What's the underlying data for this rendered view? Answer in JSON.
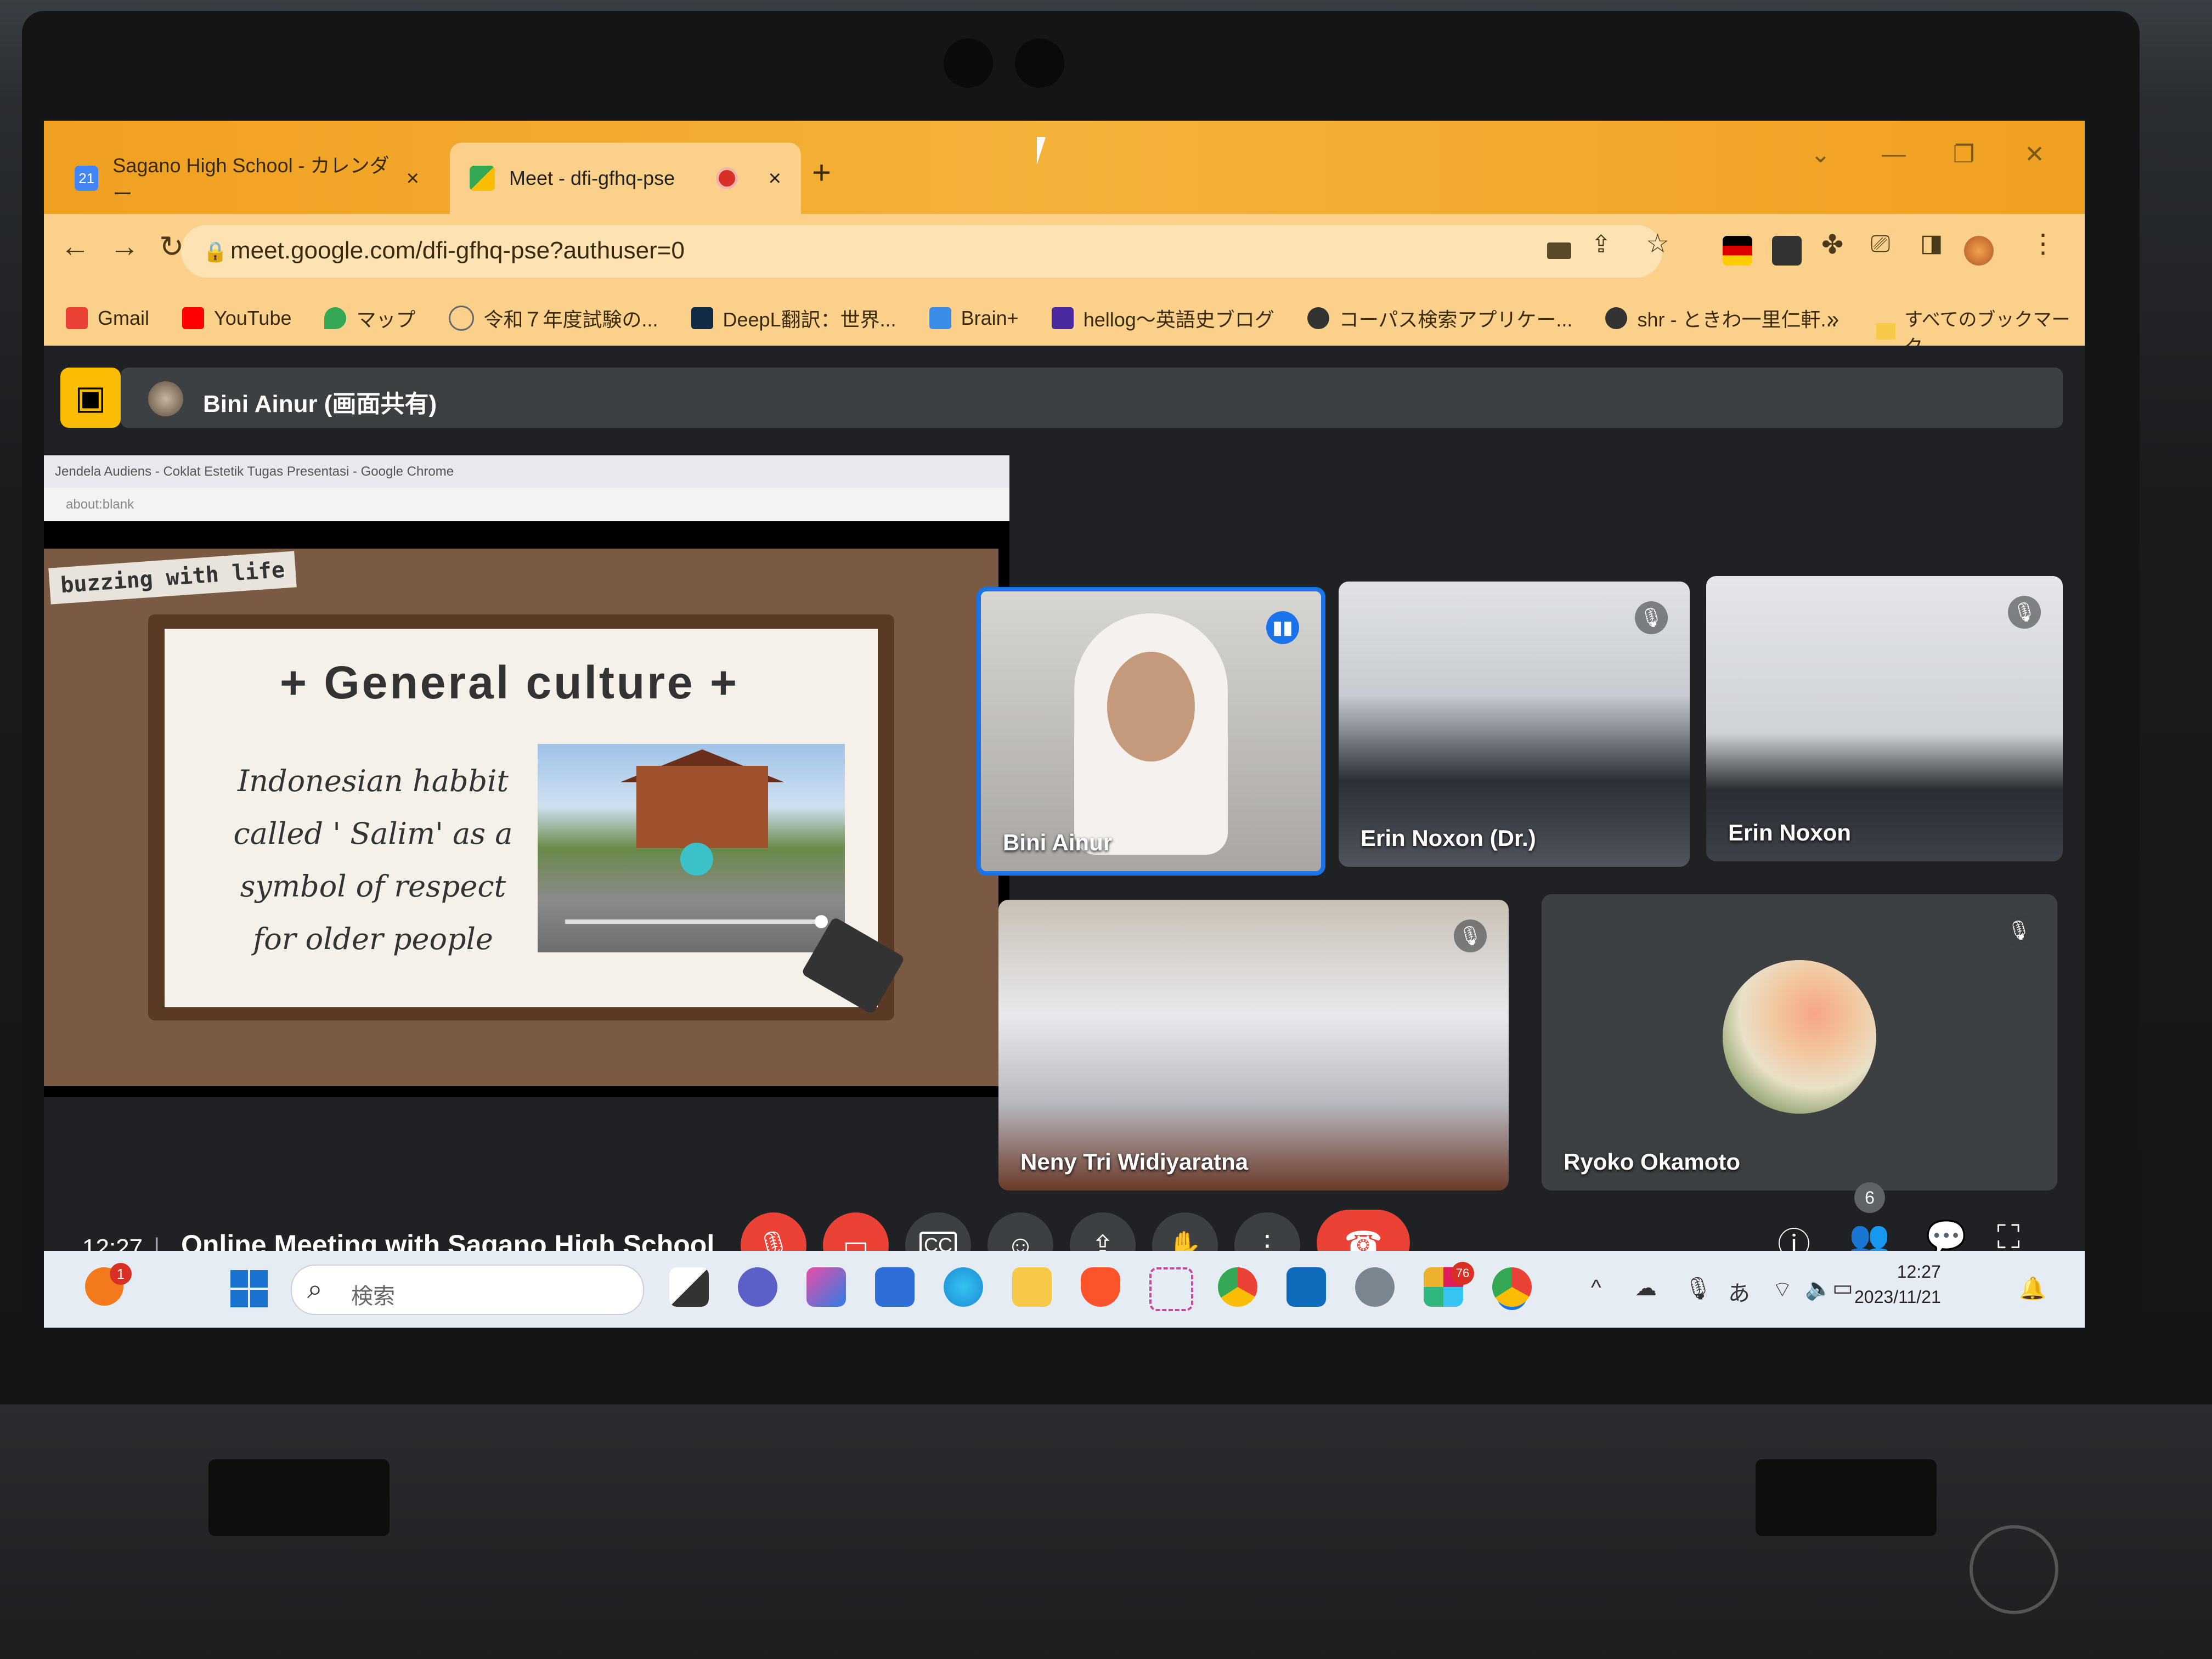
{
  "browser": {
    "tabs": [
      {
        "title": "Sagano High School - カレンダー",
        "favicon": "calendar-icon",
        "close": "×"
      },
      {
        "title": "Meet - dfi-gfhq-pse",
        "favicon": "meet-icon",
        "close": "×"
      }
    ],
    "new_tab": "+",
    "url": "meet.google.com/dfi-gfhq-pse?authuser=0",
    "bookmarks": [
      {
        "label": "Gmail",
        "icon": "gmail-icon",
        "color": "#ea4335"
      },
      {
        "label": "YouTube",
        "icon": "youtube-icon",
        "color": "#ff0000"
      },
      {
        "label": "マップ",
        "icon": "maps-icon",
        "color": "#34a853"
      },
      {
        "label": "令和７年度試験の...",
        "icon": "globe-icon",
        "color": "#6a6a6a"
      },
      {
        "label": "DeepL翻訳：世界...",
        "icon": "deepl-icon",
        "color": "#0f2b46"
      },
      {
        "label": "Brain+",
        "icon": "brain-icon",
        "color": "#3a8ee6"
      },
      {
        "label": "hellog〜英語史ブログ",
        "icon": "hellog-icon",
        "color": "#4a2aa0"
      },
      {
        "label": "コーパス検索アプリケー...",
        "icon": "globe-icon",
        "color": "#333333"
      },
      {
        "label": "shr - ときわ一里仁軒...",
        "icon": "globe-icon",
        "color": "#333333"
      }
    ],
    "bookmarks_more": "»",
    "all_bookmarks": "すべてのブックマーク"
  },
  "meet": {
    "presenter": "Bini Ainur (画面共有)",
    "shared_window": {
      "title": "Jendela Audiens - Coklat Estetik Tugas Presentasi - Google Chrome",
      "address": "about:blank"
    },
    "slide": {
      "tag": "buzzing with life",
      "title": "+ General culture +",
      "body": "Indonesian habbit called ' Salim' as a symbol of respect for older people"
    },
    "participants": [
      {
        "name": "Bini Ainur",
        "status": "speaking"
      },
      {
        "name": "Erin Noxon (Dr.)",
        "status": "muted"
      },
      {
        "name": "Erin Noxon",
        "status": "muted"
      },
      {
        "name": "Neny Tri Widiyaratna",
        "status": "muted"
      },
      {
        "name": "Ryoko Okamoto",
        "status": "muted"
      }
    ],
    "time": "12:27",
    "separator": "|",
    "meeting_title": "Online Meeting with Sagano High School",
    "participant_count": "6"
  },
  "taskbar": {
    "notification_count": "1",
    "search_placeholder": "検索",
    "app_badge": "76",
    "ime": "あ",
    "clock_time": "12:27",
    "clock_date": "2023/11/21"
  },
  "colors": {
    "tab_bar": "#f0a020",
    "meet_bg": "#202124",
    "end_call": "#ea4335",
    "accent": "#1a73e8",
    "present_button": "#fbbc04"
  }
}
